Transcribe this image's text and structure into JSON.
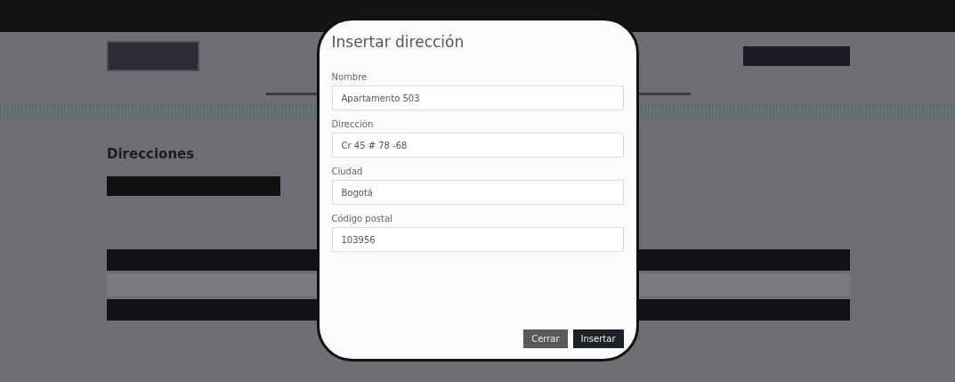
{
  "page": {
    "heading": "Direcciones"
  },
  "dialog": {
    "title": "Insertar dirección",
    "fields": [
      {
        "label": "Nombre",
        "value": "Apartamento 503"
      },
      {
        "label": "Dirección",
        "value": "Cr 45 # 78 -68"
      },
      {
        "label": "Ciudad",
        "value": "Bogotá"
      },
      {
        "label": "Código postal",
        "value": "103956"
      }
    ],
    "buttons": [
      {
        "label": "Cerrar",
        "kind": "secondary"
      },
      {
        "label": "Insertar",
        "kind": "primary"
      }
    ]
  }
}
